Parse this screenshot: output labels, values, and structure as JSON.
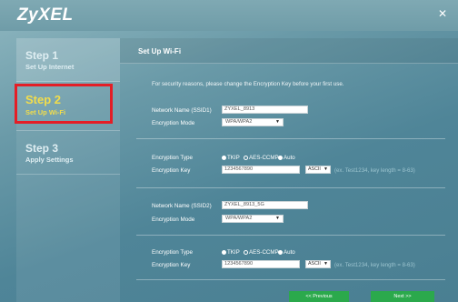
{
  "app": {
    "logo": "ZyXEL",
    "close": "✕"
  },
  "sidebar": {
    "steps": [
      {
        "title": "Step 1",
        "subtitle": "Set Up Internet"
      },
      {
        "title": "Step 2",
        "subtitle": "Set Up Wi-Fi"
      },
      {
        "title": "Step 3",
        "subtitle": "Apply Settings"
      }
    ]
  },
  "main": {
    "title": "Set Up Wi-Fi",
    "note": "For security reasons, please change the Encryption Key before your first use.",
    "ssid1": {
      "name_label": "Network Name (SSID1)",
      "name_value": "ZYXEL_8913",
      "mode_label": "Encryption Mode",
      "mode_value": "WPA/WPA2",
      "type_label": "Encryption Type",
      "type_options": [
        "TKIP",
        "AES-CCMP",
        "Auto"
      ],
      "type_selected": "Auto",
      "key_label": "Encryption Key",
      "key_value": "1234567890",
      "key_format": "ASCII",
      "key_hint": "(ex. Test1234, key length = 8-63)"
    },
    "ssid2": {
      "name_label": "Network Name (SSID2)",
      "name_value": "ZYXEL_8913_5G",
      "mode_label": "Encryption Mode",
      "mode_value": "WPA/WPA2",
      "type_label": "Encryption Type",
      "type_options": [
        "TKIP",
        "AES-CCMP",
        "Auto"
      ],
      "type_selected": "Auto",
      "key_label": "Encryption Key",
      "key_value": "1234567890",
      "key_format": "ASCII",
      "key_hint": "(ex. Test1234, key length = 8-63)"
    },
    "buttons": {
      "previous": "<< Previous",
      "next": "Next >>"
    }
  },
  "colors": {
    "accent_yellow": "#f2dd4b",
    "highlight_red": "#e41e26",
    "button_green": "#2ba94c"
  },
  "icons": {
    "close": "close-icon",
    "dropdown": "chevron-down-icon"
  }
}
